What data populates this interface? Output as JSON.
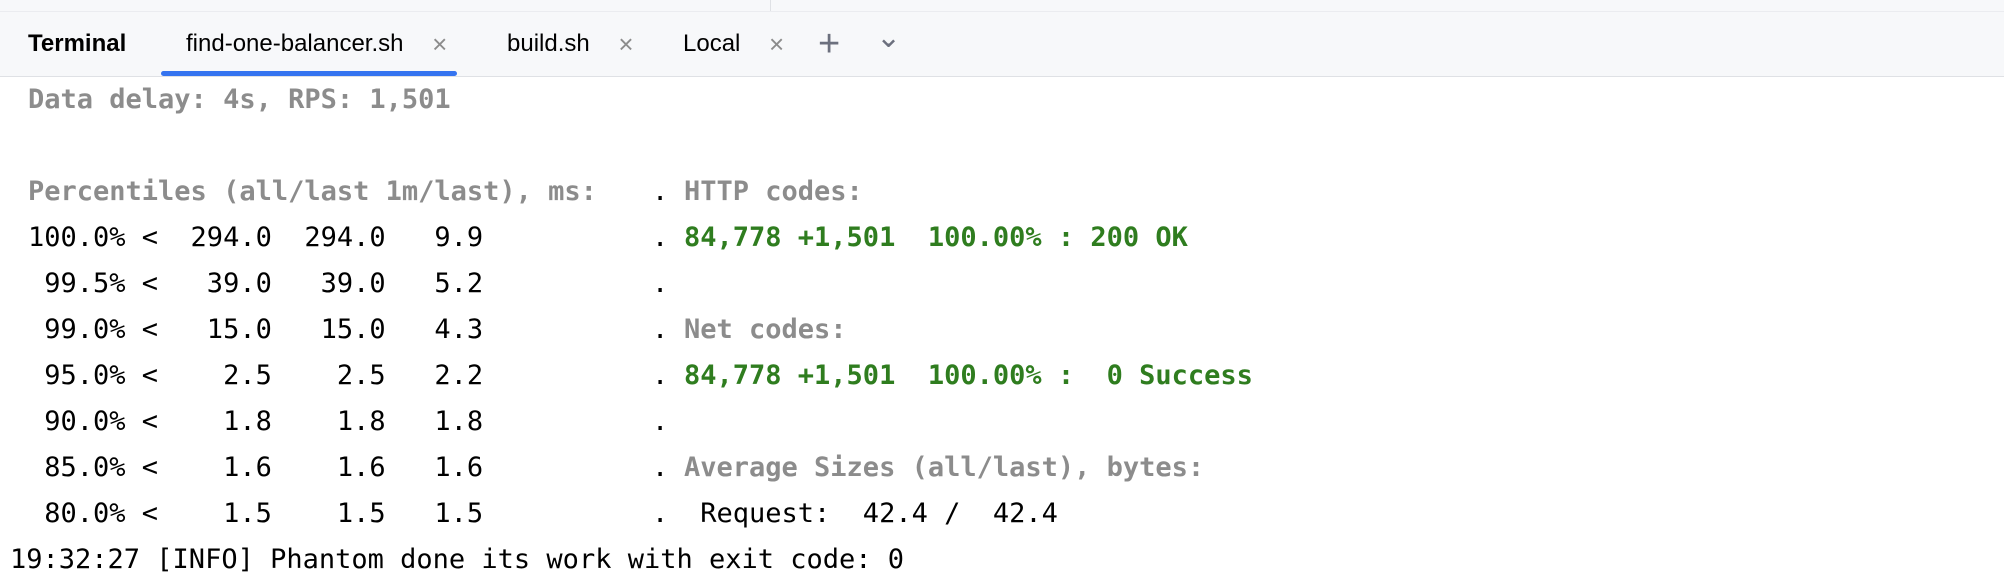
{
  "tabbar": {
    "title": "Terminal",
    "tabs": [
      {
        "label": "find-one-balancer.sh",
        "active": true
      },
      {
        "label": "build.sh",
        "active": false
      },
      {
        "label": "Local",
        "active": false
      }
    ],
    "close_glyph": "×",
    "add_glyph": "+",
    "chevron_glyph": "⌄"
  },
  "terminal": {
    "status_line": "Data delay: 4s, RPS: 1,501",
    "percentiles_header": "Percentiles (all/last 1m/last), ms:",
    "http_header": "HTTP codes:",
    "net_header": "Net codes:",
    "sizes_header": "Average Sizes (all/last), bytes:",
    "separator": ".",
    "percentile_rows": [
      "100.0% <  294.0  294.0   9.9",
      " 99.5% <   39.0   39.0   5.2",
      " 99.0% <   15.0   15.0   4.3",
      " 95.0% <    2.5    2.5   2.2",
      " 90.0% <    1.8    1.8   1.8",
      " 85.0% <    1.6    1.6   1.6",
      " 80.0% <    1.5    1.5   1.5"
    ],
    "http_row": "84,778 +1,501  100.00% : 200 OK",
    "net_row": "84,778 +1,501  100.00% :  0 Success",
    "request_row": " Request:  42.4 /  42.4",
    "info_line": "19:32:27 [INFO] Phantom done its work with exit code: 0",
    "rps_bar_fill": 1.0,
    "request_bar_fill": 1.0,
    "colors": {
      "header_gray": "#8c8c8c",
      "ok_green": "#2f7d1f",
      "accent_blue": "#3574f0",
      "rps_bar": "#8c8c8c",
      "request_bar": "#000000"
    }
  }
}
